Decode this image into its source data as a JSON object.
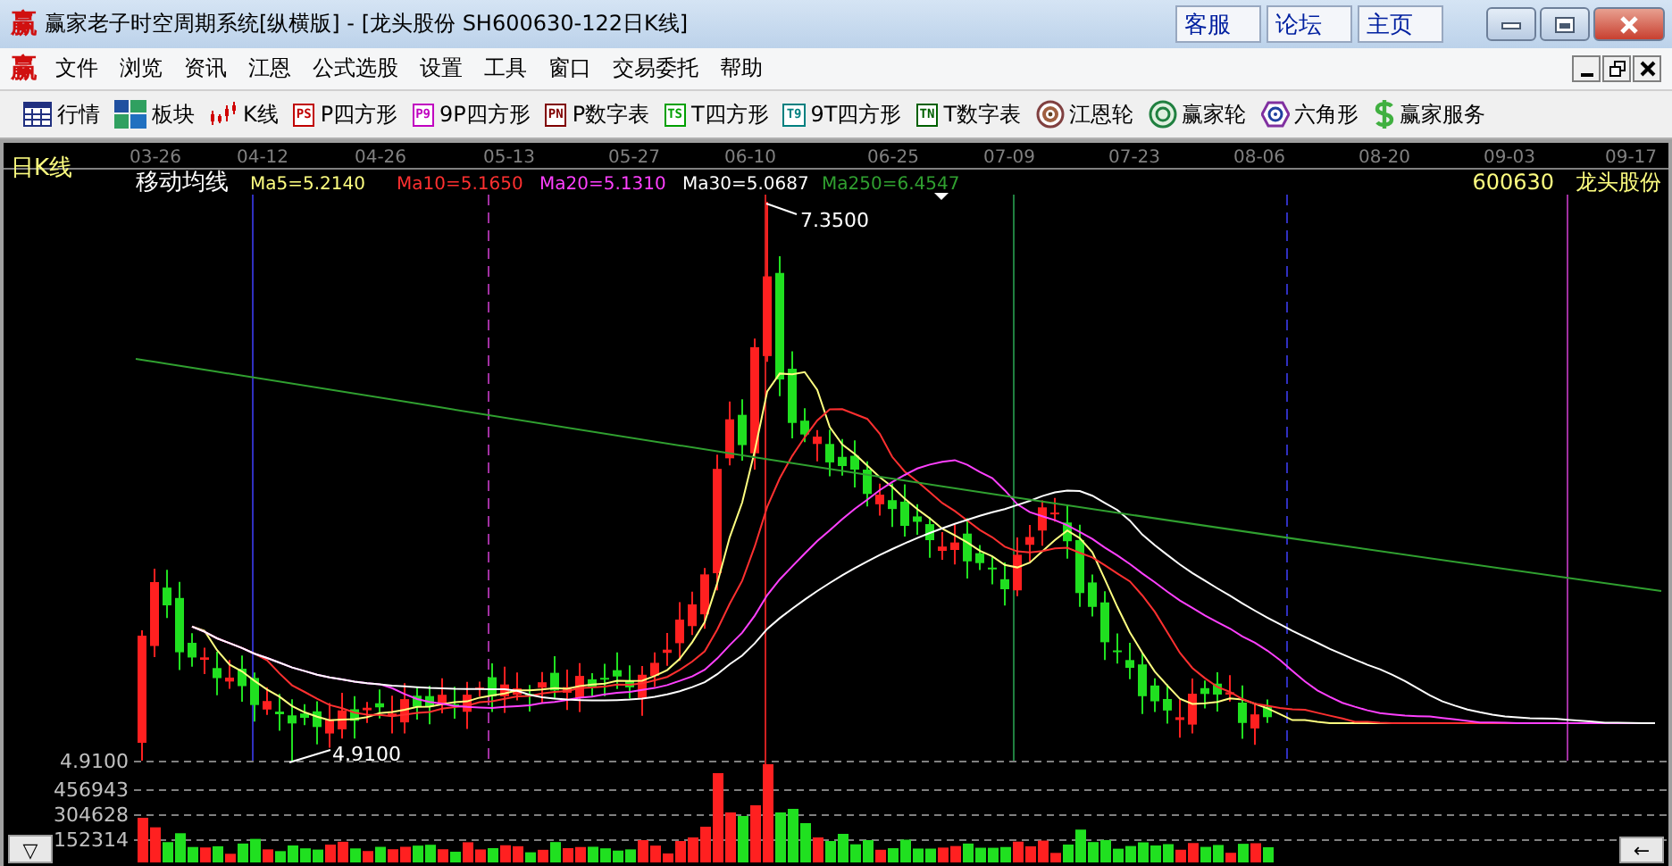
{
  "window": {
    "logo": "赢",
    "title": "赢家老子时空周期系统[纵横版] - [龙头股份  SH600630-122日K线]",
    "links": [
      "客服",
      "论坛",
      "主页"
    ]
  },
  "menu": {
    "logo": "赢",
    "items": [
      "文件",
      "浏览",
      "资讯",
      "江恩",
      "公式选股",
      "设置",
      "工具",
      "窗口",
      "交易委托",
      "帮助"
    ]
  },
  "toolbar": [
    {
      "kind": "grid",
      "label": "行情"
    },
    {
      "kind": "blocks",
      "label": "板块"
    },
    {
      "kind": "candles",
      "label": "K线"
    },
    {
      "kind": "badge",
      "badge": "PS",
      "color": "#c00000",
      "label": "P四方形"
    },
    {
      "kind": "badge",
      "badge": "P9",
      "color": "#c000c0",
      "label": "9P四方形"
    },
    {
      "kind": "badge",
      "badge": "PN",
      "color": "#800000",
      "label": "P数字表"
    },
    {
      "kind": "badge",
      "badge": "TS",
      "color": "#00a000",
      "label": "T四方形"
    },
    {
      "kind": "badge",
      "badge": "T9",
      "color": "#008080",
      "label": "9T四方形"
    },
    {
      "kind": "badge",
      "badge": "TN",
      "color": "#006000",
      "label": "T数字表"
    },
    {
      "kind": "target",
      "label": "江恩轮"
    },
    {
      "kind": "wheel",
      "label": "赢家轮"
    },
    {
      "kind": "hexagon",
      "label": "六角形"
    },
    {
      "kind": "dollar",
      "label": "赢家服务"
    }
  ],
  "chart": {
    "period": "日K线",
    "dates": [
      "03-26",
      "04-12",
      "04-26",
      "05-13",
      "05-27",
      "06-10",
      "06-25",
      "07-09",
      "07-23",
      "08-06",
      "08-20",
      "09-03",
      "09-17"
    ],
    "indicator": "移动均线",
    "ma_readings": [
      {
        "text": "Ma5=5.2140",
        "color": "#ffff80"
      },
      {
        "text": "Ma10=5.1650",
        "color": "#ff3030"
      },
      {
        "text": "Ma20=5.1310",
        "color": "#ff40ff"
      },
      {
        "text": "Ma30=5.0687",
        "color": "#ffffff"
      },
      {
        "text": "Ma250=6.4547",
        "color": "#30a030"
      }
    ],
    "code": "600630",
    "name": "龙头股份",
    "high_label": "7.3500",
    "low_label": "4.9100",
    "price_axis": [
      "4.9100"
    ],
    "volume_axis": [
      "456943",
      "304628",
      "152314"
    ],
    "collapse_button": "▽",
    "back_button": "←"
  }
}
